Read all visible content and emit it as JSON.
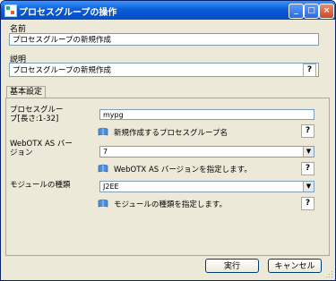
{
  "window": {
    "title": "プロセスグループの操作",
    "controls": [
      "_",
      "□",
      "×"
    ]
  },
  "name_section": {
    "label": "名前",
    "value": "プロセスグループの新規作成"
  },
  "desc_section": {
    "label": "説明",
    "value": "プロセスグループの新規作成",
    "help": "?"
  },
  "tab": {
    "label": "基本設定"
  },
  "fields": [
    {
      "label": "プロセスグルー\nプ[長さ:1-32]",
      "value": "mypg",
      "desc": "新規作成するプロセスグループ名",
      "help": "?"
    },
    {
      "label": "WebOTX AS バー\nジョン",
      "value": "7",
      "desc": "WebOTX AS バージョンを指定します。",
      "help": "?"
    },
    {
      "label": "モジュールの種類",
      "value": "J2EE",
      "desc": "モジュールの種類を指定します。",
      "help": "?"
    }
  ],
  "buttons": {
    "run": "実行",
    "cancel": "キャンセル"
  },
  "colors": {
    "titlebar": "#0554d1",
    "dialog_bg": "#ece9d8"
  }
}
